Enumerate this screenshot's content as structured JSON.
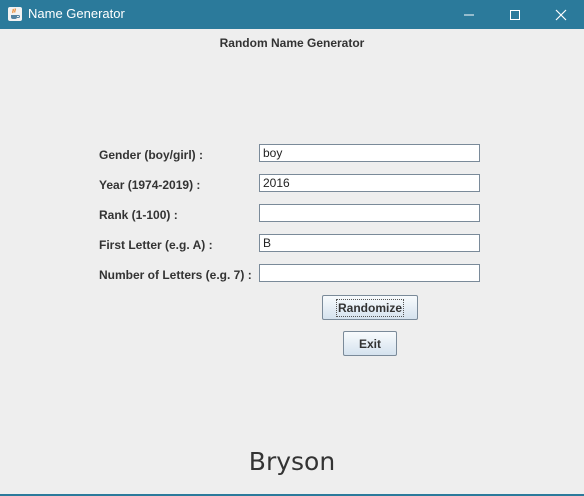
{
  "window": {
    "title": "Name Generator",
    "title_bar_color": "#2b7a9b"
  },
  "form": {
    "heading": "Random Name Generator",
    "fields": [
      {
        "label": "Gender (boy/girl) :",
        "value": ""
      },
      {
        "label": "Year (1974-2019) :",
        "value": "2016"
      },
      {
        "label": "Rank (1-100) :",
        "value": ""
      },
      {
        "label": "First Letter (e.g. A) :",
        "value": "B"
      },
      {
        "label": "Number of Letters (e.g. 7) :",
        "value": ""
      }
    ],
    "gender_value": "boy"
  },
  "buttons": {
    "randomize": "Randomize",
    "exit": "Exit"
  },
  "result": {
    "name": "Bryson"
  }
}
